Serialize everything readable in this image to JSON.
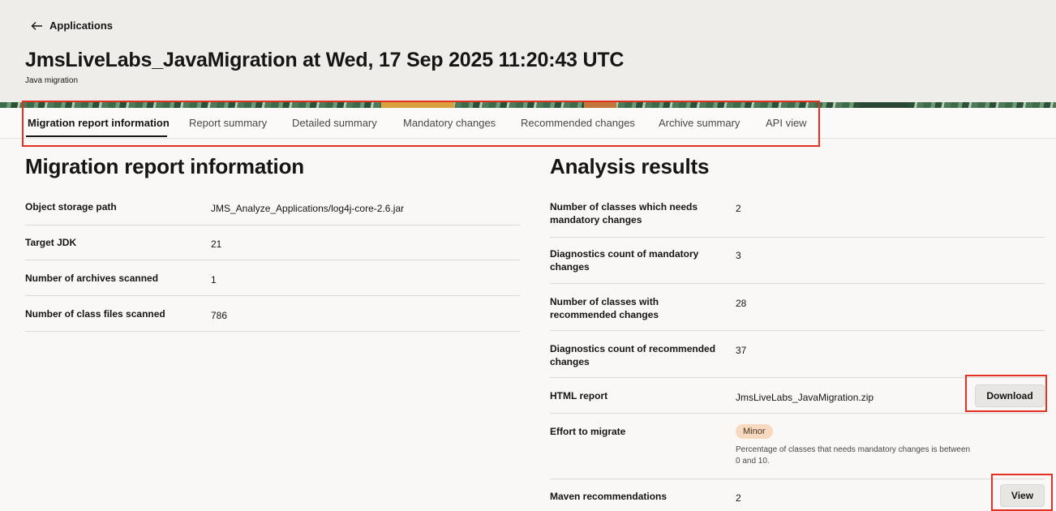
{
  "header": {
    "back_label": "Applications",
    "title": "JmsLiveLabs_JavaMigration at Wed, 17 Sep 2025 11:20:43 UTC",
    "subtitle": "Java migration"
  },
  "tabs": [
    {
      "label": "Migration report information",
      "active": true
    },
    {
      "label": "Report summary",
      "active": false
    },
    {
      "label": "Detailed summary",
      "active": false
    },
    {
      "label": "Mandatory changes",
      "active": false
    },
    {
      "label": "Recommended changes",
      "active": false
    },
    {
      "label": "Archive summary",
      "active": false
    },
    {
      "label": "API view",
      "active": false
    }
  ],
  "report_info": {
    "heading": "Migration report information",
    "rows": [
      {
        "label": "Object storage path",
        "value": "JMS_Analyze_Applications/log4j-core-2.6.jar"
      },
      {
        "label": "Target JDK",
        "value": "21"
      },
      {
        "label": "Number of archives scanned",
        "value": "1"
      },
      {
        "label": "Number of class files scanned",
        "value": "786"
      }
    ]
  },
  "analysis": {
    "heading": "Analysis results",
    "rows": [
      {
        "label": "Number of classes which needs mandatory changes",
        "value": "2"
      },
      {
        "label": "Diagnostics count of mandatory changes",
        "value": "3"
      },
      {
        "label": "Number of classes with recommended changes",
        "value": "28"
      },
      {
        "label": "Diagnostics count of recommended changes",
        "value": "37"
      }
    ],
    "html_report": {
      "label": "HTML report",
      "value": "JmsLiveLabs_JavaMigration.zip",
      "button": "Download"
    },
    "effort": {
      "label": "Effort to migrate",
      "badge": "Minor",
      "note": "Percentage of classes that needs mandatory changes is between 0 and 10."
    },
    "maven": {
      "label": "Maven recommendations",
      "value": "2",
      "button": "View"
    }
  },
  "colors": {
    "highlight": "#e33023",
    "badge_bg": "#f7d9bf"
  }
}
